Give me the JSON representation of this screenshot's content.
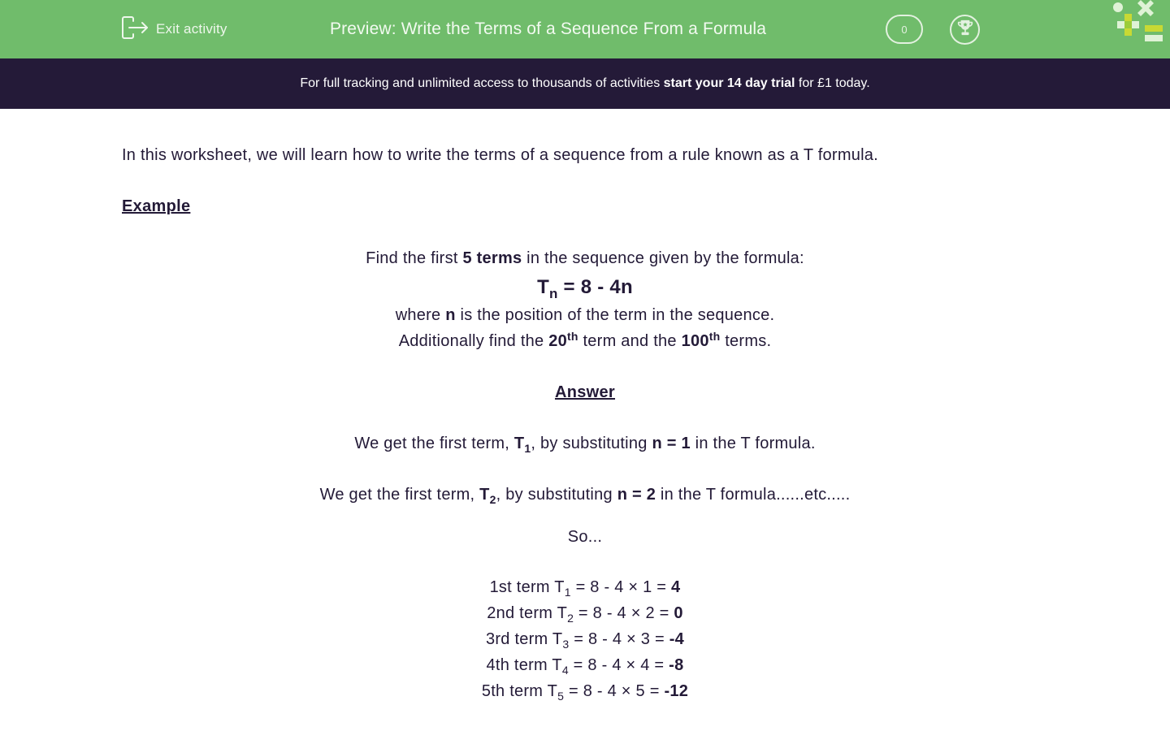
{
  "header": {
    "exit_label": "Exit activity",
    "title": "Preview: Write the Terms of a Sequence From a Formula",
    "score": "0",
    "icons": [
      "exit-icon",
      "trophy-icon",
      "logo-icon"
    ],
    "colors": {
      "topbar": "#70bc6b",
      "banner": "#241a38",
      "text": "#231a37"
    }
  },
  "banner": {
    "pre": "For full tracking and unlimited access to thousands of activities ",
    "cta": "start your 14 day trial",
    "post": " for £1 today."
  },
  "intro": "In this worksheet, we will learn how to write the terms of a sequence from a rule known as a T formula.",
  "example": {
    "heading": "Example",
    "q1_pre": "Find the first ",
    "q1_bold": "5 terms",
    "q1_post": " in the sequence given by the formula:",
    "formula_T": "T",
    "formula_sub": "n",
    "formula_rest": " = 8 - 4n",
    "q2_pre": "where ",
    "q2_bold": "n",
    "q2_post": " is the position of the term in the sequence.",
    "q3_pre": "Additionally find the ",
    "q3_b1": "20",
    "q3_s1": "th",
    "q3_mid": " term and the ",
    "q3_b2": "100",
    "q3_s2": "th",
    "q3_post": " terms."
  },
  "answer": {
    "heading": "Answer",
    "line1": {
      "pre": "We get the first term, ",
      "T": "T",
      "sub": "1",
      "mid": ", by substituting ",
      "bold": "n = 1",
      "post": " in the T formula."
    },
    "line2": {
      "pre": "We get the first term, ",
      "T": "T",
      "sub": "2",
      "mid": ", by substituting ",
      "bold": "n = 2",
      "post": " in the T formula......etc....."
    },
    "so": "So...",
    "terms": [
      {
        "label": "1st term T",
        "sub": "1",
        "expr": " = 8 - 4 × 1 = ",
        "result": "4"
      },
      {
        "label": "2nd term T",
        "sub": "2",
        "expr": " = 8 - 4 × 2 = ",
        "result": "0"
      },
      {
        "label": "3rd term T",
        "sub": "3",
        "expr": " = 8 - 4 × 3 = ",
        "result": "-4"
      },
      {
        "label": "4th term T",
        "sub": "4",
        "expr": " = 8 - 4 × 4 = ",
        "result": "-8"
      },
      {
        "label": "5th term T",
        "sub": "5",
        "expr": " = 8 - 4 × 5 = ",
        "result": "-12"
      }
    ]
  }
}
